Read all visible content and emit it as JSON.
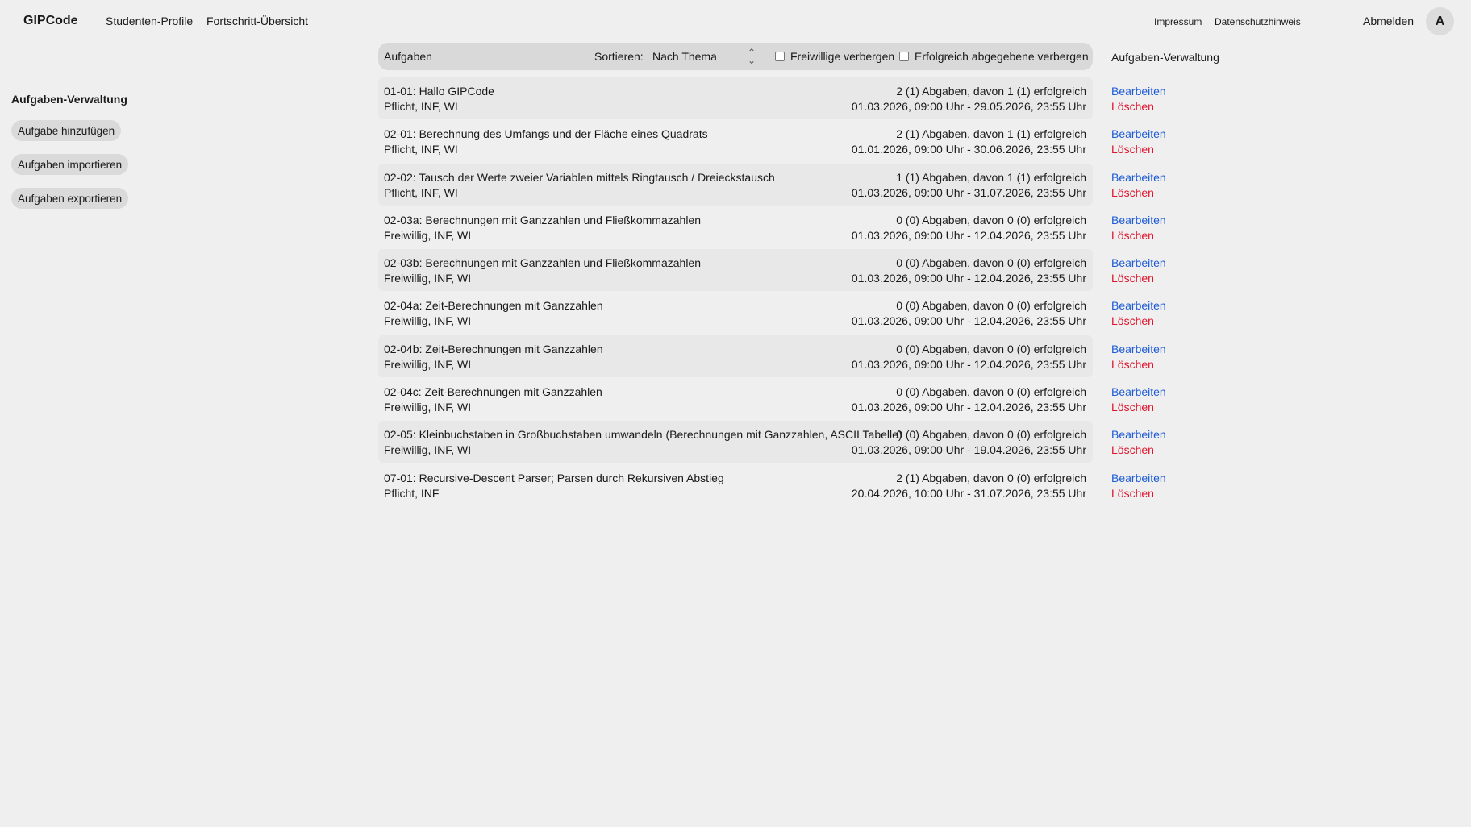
{
  "header": {
    "brand": "GIPCode",
    "nav": [
      "Studenten-Profile",
      "Fortschritt-Übersicht"
    ],
    "impressum": "Impressum",
    "datenschutz": "Datenschutzhinweis",
    "logout": "Abmelden",
    "avatar_initial": "A"
  },
  "sidebar": {
    "title": "Aufgaben-Verwaltung",
    "buttons": [
      "Aufgabe hinzufügen",
      "Aufgaben importieren",
      "Aufgaben exportieren"
    ]
  },
  "toolbar": {
    "title": "Aufgaben",
    "sort_label": "Sortieren:",
    "sort_value": "Nach Thema",
    "hide_optional": "Freiwillige verbergen",
    "hide_successful": "Erfolgreich abgegebene verbergen"
  },
  "right_heading": "Aufgaben-Verwaltung",
  "actions": {
    "edit": "Bearbeiten",
    "delete": "Löschen"
  },
  "tasks": [
    {
      "title": "01-01: Hallo GIPCode",
      "tags": "Pflicht, INF, WI",
      "stats": "2 (1) Abgaben, davon 1 (1) erfolgreich",
      "dates": "01.03.2026, 09:00 Uhr - 29.05.2026, 23:55 Uhr"
    },
    {
      "title": "02-01: Berechnung des Umfangs und der Fläche eines Quadrats",
      "tags": "Pflicht, INF, WI",
      "stats": "2 (1) Abgaben, davon 1 (1) erfolgreich",
      "dates": "01.01.2026, 09:00 Uhr - 30.06.2026, 23:55 Uhr"
    },
    {
      "title": "02-02: Tausch der Werte zweier Variablen mittels Ringtausch / Dreieckstausch",
      "tags": "Pflicht, INF, WI",
      "stats": "1 (1) Abgaben, davon 1 (1) erfolgreich",
      "dates": "01.03.2026, 09:00 Uhr - 31.07.2026, 23:55 Uhr"
    },
    {
      "title": "02-03a: Berechnungen mit Ganzzahlen und Fließkommazahlen",
      "tags": "Freiwillig, INF, WI",
      "stats": "0 (0) Abgaben, davon 0 (0) erfolgreich",
      "dates": "01.03.2026, 09:00 Uhr - 12.04.2026, 23:55 Uhr"
    },
    {
      "title": "02-03b: Berechnungen mit Ganzzahlen und Fließkommazahlen",
      "tags": "Freiwillig, INF, WI",
      "stats": "0 (0) Abgaben, davon 0 (0) erfolgreich",
      "dates": "01.03.2026, 09:00 Uhr - 12.04.2026, 23:55 Uhr"
    },
    {
      "title": "02-04a: Zeit-Berechnungen mit Ganzzahlen",
      "tags": "Freiwillig, INF, WI",
      "stats": "0 (0) Abgaben, davon 0 (0) erfolgreich",
      "dates": "01.03.2026, 09:00 Uhr - 12.04.2026, 23:55 Uhr"
    },
    {
      "title": "02-04b: Zeit-Berechnungen mit Ganzzahlen",
      "tags": "Freiwillig, INF, WI",
      "stats": "0 (0) Abgaben, davon 0 (0) erfolgreich",
      "dates": "01.03.2026, 09:00 Uhr - 12.04.2026, 23:55 Uhr"
    },
    {
      "title": "02-04c: Zeit-Berechnungen mit Ganzzahlen",
      "tags": "Freiwillig, INF, WI",
      "stats": "0 (0) Abgaben, davon 0 (0) erfolgreich",
      "dates": "01.03.2026, 09:00 Uhr - 12.04.2026, 23:55 Uhr"
    },
    {
      "title": "02-05: Kleinbuchstaben in Großbuchstaben umwandeln (Berechnungen mit Ganzzahlen, ASCII Tabelle)",
      "tags": "Freiwillig, INF, WI",
      "stats": "0 (0) Abgaben, davon 0 (0) erfolgreich",
      "dates": "01.03.2026, 09:00 Uhr - 19.04.2026, 23:55 Uhr"
    },
    {
      "title": "07-01: Recursive-Descent Parser; Parsen durch Rekursiven Abstieg",
      "tags": "Pflicht, INF",
      "stats": "2 (1) Abgaben, davon 0 (0) erfolgreich",
      "dates": "20.04.2026, 10:00 Uhr - 31.07.2026, 23:55 Uhr"
    }
  ]
}
